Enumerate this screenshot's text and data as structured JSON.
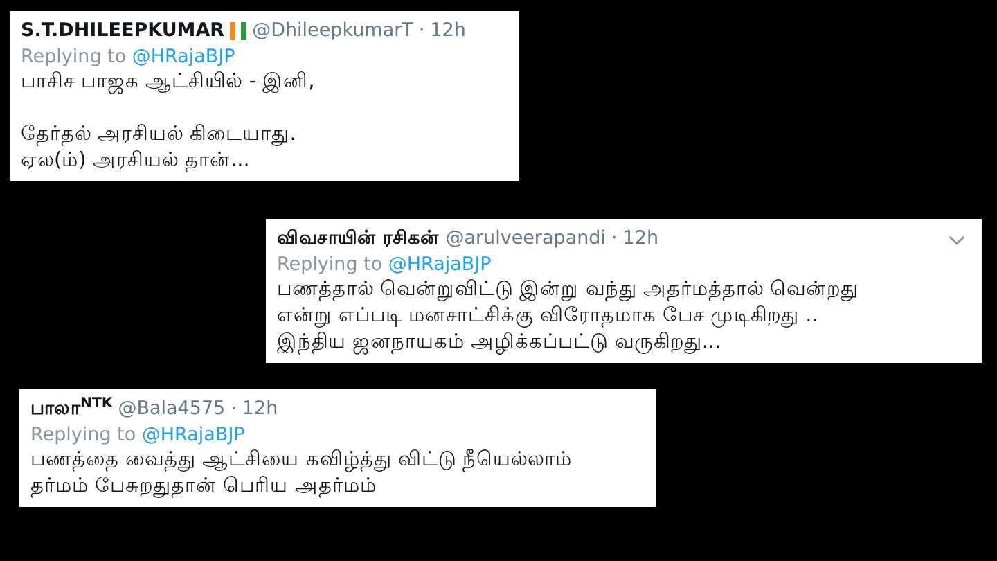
{
  "tweets": [
    {
      "name": "S.T.DHILEEPKUMAR",
      "has_flag": true,
      "handle": "@DhileepkumarT",
      "separator": "·",
      "time": "12h",
      "menu": false,
      "replying_label": "Replying to",
      "reply_to": "@HRajaBJP",
      "paragraphs": [
        [
          "பாசிச பாஜக ஆட்சியில் - இனி,"
        ],
        [
          "தேர்தல் அரசியல் கிடையாது.",
          "ஏல(ம்) அரசியல் தான்..."
        ]
      ]
    },
    {
      "name": "விவசாயின் ரசிகன்",
      "has_flag": false,
      "handle": "@arulveerapandi",
      "separator": "·",
      "time": "12h",
      "menu": true,
      "replying_label": "Replying to",
      "reply_to": "@HRajaBJP",
      "paragraphs": [
        [
          "பணத்தால் வென்றுவிட்டு இன்று வந்து அதர்மத்தால் வென்றது",
          "என்று எப்படி மனசாட்சிக்கு விரோதமாக பேச முடிகிறது ..",
          "இந்திய ஜனநாயகம் அழிக்கப்பட்டு வருகிறது..."
        ]
      ]
    },
    {
      "name": "பாலா$^{NTK}$",
      "has_flag": false,
      "handle": "@Bala4575",
      "separator": "·",
      "time": "12h",
      "menu": false,
      "replying_label": "Replying to",
      "reply_to": "@HRajaBJP",
      "paragraphs": [
        [
          "பணத்தை வைத்து ஆட்சியை கவிழ்த்து விட்டு நீயெல்லாம்",
          "தர்மம் பேசுறதுதான் பெரிய அதர்மம்"
        ]
      ]
    }
  ]
}
